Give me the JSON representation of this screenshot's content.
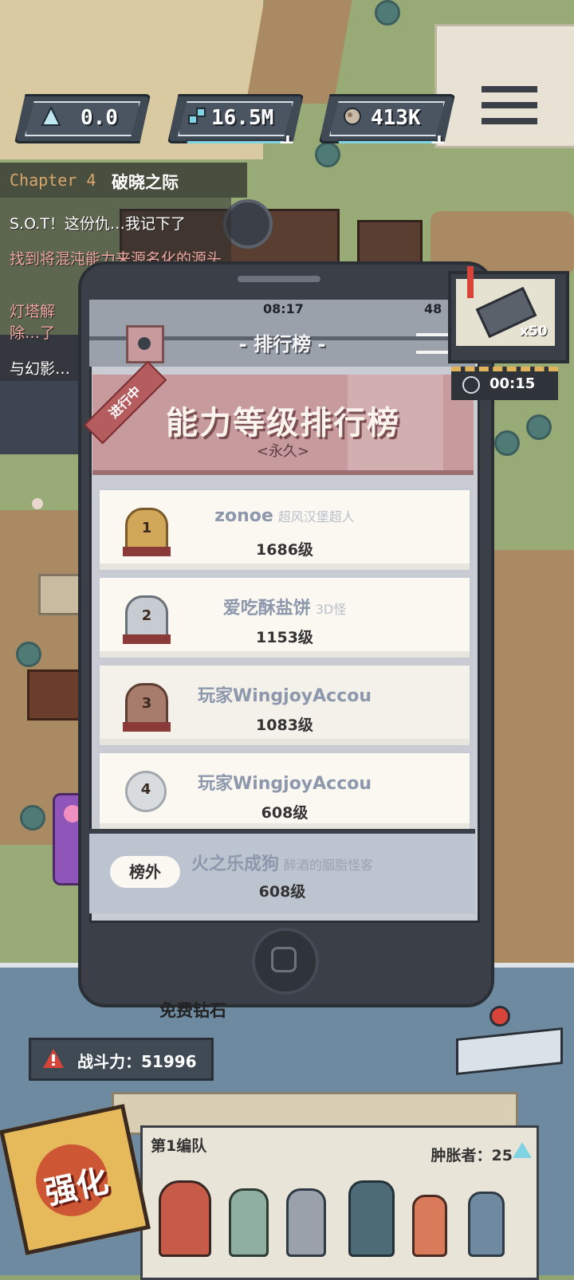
{
  "resources": [
    {
      "icon": "crystal-icon",
      "value": "0.0"
    },
    {
      "icon": "gem-cluster-icon",
      "value": "16.5M"
    },
    {
      "icon": "ore-icon",
      "value": "413K"
    }
  ],
  "quest": {
    "chapter": "Chapter 4",
    "chapter_title": "破晓之际",
    "lines": [
      "S.O.T！这份仇…我记下了",
      "找到将混沌能力来源名化的源头",
      "灯塔解除…了",
      "与幻影…"
    ]
  },
  "phone": {
    "time": "08:17",
    "battery": "48",
    "header_title": "- 排行榜 -",
    "badge": "进行中",
    "banner_title": "能力等级排行榜",
    "banner_sub": "<永久>",
    "entries": [
      {
        "rank": "1",
        "name": "zonoe",
        "sub": "超风汉堡超人",
        "level": "1686级"
      },
      {
        "rank": "2",
        "name": "爱吃酥盐饼",
        "sub": "3D怪",
        "level": "1153级"
      },
      {
        "rank": "3",
        "name": "玩家WingjoyAccou",
        "sub": "",
        "level": "1083级"
      },
      {
        "rank": "4",
        "name": "玩家WingjoyAccou",
        "sub": "",
        "level": "608级"
      }
    ],
    "self": {
      "label": "榜外",
      "name": "火之乐成狗",
      "sub": "醉酒的胭脂怪客",
      "level": "608级"
    }
  },
  "reward": {
    "count": "x50",
    "timer": "00:15"
  },
  "free_diamond": "免费钻石",
  "power": {
    "label": "战斗力：51996"
  },
  "strengthen": "强化",
  "team": {
    "name": "第1编队",
    "count_label": "肿胀者：25"
  },
  "colors": {
    "accent_blue": "#7fd3e2",
    "banner_pink": "#c79a9d",
    "danger_red": "#d9443a"
  }
}
